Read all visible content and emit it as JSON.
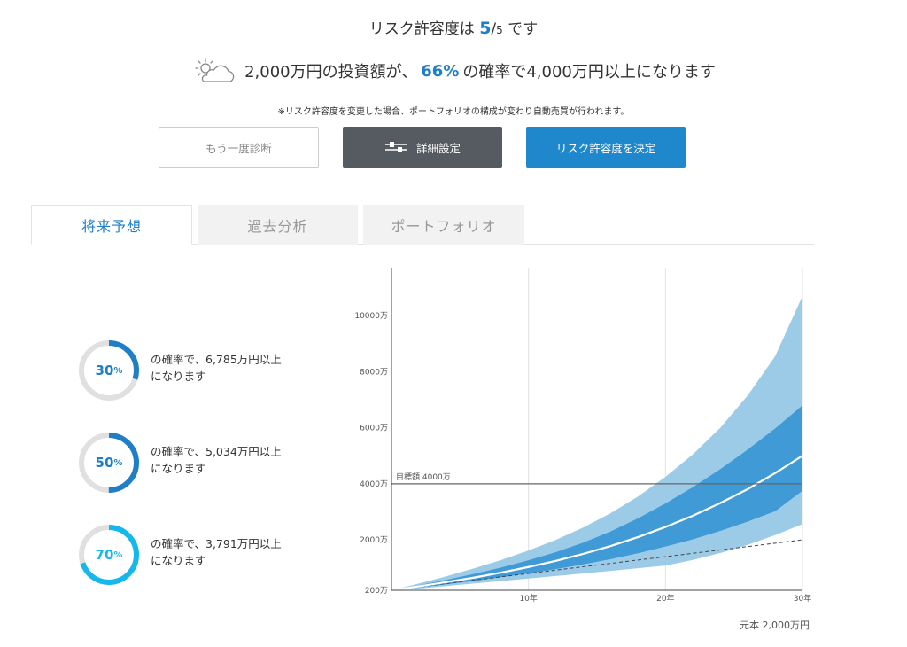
{
  "header": {
    "risk_prefix": "リスク許容度は ",
    "risk_level": "5",
    "risk_max": "5",
    "risk_suffix": " です",
    "headline_prefix": "2,000万円の投資額が、",
    "headline_probability": "66%",
    "headline_suffix": "の確率で4,000万円以上になります",
    "notice": "※リスク許容度を変更した場合、ポートフォリオの構成が変わり自動売買が行われます。",
    "weather_icon": "partly-cloudy-icon"
  },
  "buttons": {
    "rediagnose": "もう一度診断",
    "detail_settings": "詳細設定",
    "decide": "リスク許容度を決定"
  },
  "tabs": {
    "future": "将来予想",
    "past": "過去分析",
    "portfolio": "ポートフォリオ"
  },
  "scenarios": [
    {
      "percent": "30",
      "unit": "%",
      "line1": "の確率で、6,785万円以上",
      "line2": "になります",
      "fraction": 0.3,
      "color": "#1f7fc6"
    },
    {
      "percent": "50",
      "unit": "%",
      "line1": "の確率で、5,034万円以上",
      "line2": "になります",
      "fraction": 0.5,
      "color": "#1f7fc6"
    },
    {
      "percent": "70",
      "unit": "%",
      "line1": "の確率で、3,791万円以上",
      "line2": "になります",
      "fraction": 0.7,
      "color": "#15b8ec"
    }
  ],
  "colors": {
    "accent": "#1f7fc6",
    "band_outer": "#9ccbe8",
    "band_inner": "#3f9ad6",
    "median_line": "#ffffff",
    "principal_line": "#444444",
    "target_line": "#666666"
  },
  "chart_data": {
    "type": "area",
    "x": [
      0,
      2,
      4,
      6,
      8,
      10,
      12,
      14,
      16,
      18,
      20,
      22,
      24,
      26,
      28,
      30
    ],
    "outer_upper": [
      200,
      440,
      700,
      980,
      1280,
      1620,
      2000,
      2440,
      2950,
      3550,
      4250,
      5050,
      6000,
      7150,
      8550,
      10700
    ],
    "inner_upper": [
      200,
      380,
      570,
      780,
      1010,
      1270,
      1560,
      1900,
      2300,
      2770,
      3300,
      3880,
      4520,
      5220,
      5970,
      6800
    ],
    "median": [
      200,
      340,
      490,
      650,
      830,
      1030,
      1250,
      1500,
      1780,
      2100,
      2460,
      2860,
      3310,
      3810,
      4380,
      5000
    ],
    "inner_lower": [
      200,
      300,
      415,
      535,
      665,
      805,
      955,
      1125,
      1310,
      1520,
      1760,
      2020,
      2320,
      2650,
      3020,
      3750
    ],
    "outer_lower": [
      200,
      265,
      350,
      440,
      530,
      620,
      710,
      800,
      890,
      985,
      1080,
      1285,
      1530,
      1820,
      2170,
      2560
    ],
    "principal": [
      200,
      320,
      440,
      560,
      680,
      800,
      920,
      1040,
      1160,
      1280,
      1400,
      1520,
      1640,
      1760,
      1880,
      2000
    ],
    "target": 4000,
    "target_label": "目標額 4000万",
    "y_ticks": [
      200,
      2000,
      4000,
      6000,
      8000,
      10000
    ],
    "y_tick_labels": [
      "200万",
      "2000万",
      "4000万",
      "6000万",
      "8000万",
      "10000万"
    ],
    "x_ticks": [
      10,
      20,
      30
    ],
    "x_tick_labels": [
      "10年",
      "20年",
      "30年"
    ],
    "xlim": [
      0,
      30
    ],
    "ylim": [
      200,
      10700
    ],
    "footnote": "元本 2,000万円",
    "grid": true
  }
}
